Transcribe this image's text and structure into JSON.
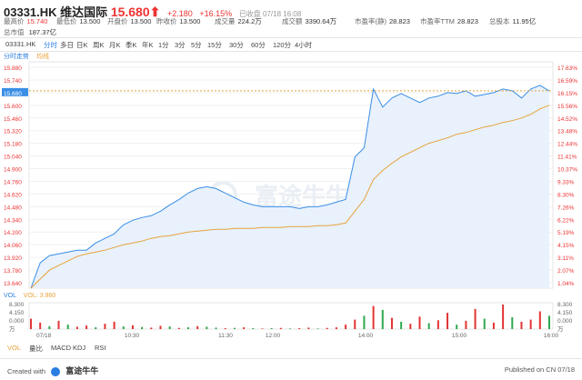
{
  "header": {
    "code": "03331.HK",
    "name": "维达国际",
    "price": "15.680",
    "arrow": "⬆",
    "change": "+2.180",
    "change_pct": "+16.15%",
    "status": "已收盘 07/18 16:08"
  },
  "stats": [
    {
      "label": "最高价",
      "value": "15.740",
      "red": true
    },
    {
      "label": "最低价",
      "value": "13.500",
      "red": false
    },
    {
      "label": "开盘价",
      "value": "13.500",
      "red": false
    },
    {
      "label": "昨收价",
      "value": "13.500",
      "red": false
    },
    {
      "label": "成交量",
      "value": "224.2万",
      "red": false
    },
    {
      "label": "成交额",
      "value": "3390.64万",
      "red": false
    },
    {
      "label": "市盈率(静)",
      "value": "28.823",
      "red": false
    },
    {
      "label": "市盈率TTM",
      "value": "28.823",
      "red": false
    },
    {
      "label": "总股本",
      "value": "11.95亿",
      "red": false
    }
  ],
  "market_cap": {
    "label": "总市值",
    "value": "187.37亿"
  },
  "tabs": [
    "03331.HK",
    "分时",
    "多日",
    "日K",
    "周K",
    "月K",
    "季K",
    "年K",
    "1分",
    "3分",
    "5分",
    "15分",
    "30分",
    "60分",
    "120分",
    "4小时"
  ],
  "active_tab": "分时",
  "legend": {
    "timeshare": "分时走势",
    "avg": "均线"
  },
  "volume_legend": {
    "label": "VOL",
    "value": "VOL: 3.960"
  },
  "bottom_tabs": [
    "VOL",
    "量比",
    "MACD",
    "KDJ",
    "RSI"
  ],
  "active_bottom_tab": "VOL",
  "footer": {
    "created_with": "Created with",
    "brand": "富途牛牛",
    "published": "Published on CN 07/18"
  },
  "watermark": "富途牛牛",
  "colors": {
    "up": "#e33333",
    "down": "#2fa84f",
    "line": "#3a8ee6",
    "avg": "#e8a23b",
    "fill": "#e8f1fc"
  },
  "chart_data": {
    "type": "line",
    "title": "",
    "xlabel": "",
    "ylabel": "",
    "x_ticks": [
      "07/18",
      "10:30",
      "11:30",
      "12:00",
      "14:00",
      "15:00",
      "16:00"
    ],
    "y_ticks": [
      "15.880",
      "15.740",
      "15.680",
      "15.600",
      "15.460",
      "15.320",
      "15.180",
      "15.040",
      "14.900",
      "14.760",
      "14.620",
      "14.480",
      "14.340",
      "14.200",
      "14.060",
      "13.920",
      "13.780",
      "13.640"
    ],
    "y_right_ticks": [
      "17.63%",
      "16.59%",
      "16.15%",
      "15.56%",
      "14.52%",
      "13.48%",
      "12.44%",
      "11.41%",
      "10.37%",
      "9.33%",
      "8.30%",
      "7.26%",
      "6.22%",
      "5.19%",
      "4.15%",
      "3.11%",
      "2.07%",
      "1.04%"
    ],
    "ylim": [
      13.5,
      16.0
    ],
    "prev_close": 13.5,
    "series": [
      {
        "name": "分时走势",
        "values": [
          13.5,
          13.78,
          13.86,
          13.88,
          13.9,
          13.92,
          13.92,
          14.0,
          14.05,
          14.1,
          14.2,
          14.25,
          14.28,
          14.3,
          14.35,
          14.42,
          14.48,
          14.55,
          14.6,
          14.62,
          14.6,
          14.55,
          14.5,
          14.45,
          14.42,
          14.4,
          14.4,
          14.4,
          14.4,
          14.38,
          14.4,
          14.4,
          14.42,
          14.45,
          14.48,
          14.95,
          15.05,
          15.7,
          15.5,
          15.6,
          15.65,
          15.6,
          15.55,
          15.6,
          15.62,
          15.66,
          15.65,
          15.68,
          15.62,
          15.64,
          15.66,
          15.7,
          15.68,
          15.6,
          15.7,
          15.74,
          15.68
        ]
      },
      {
        "name": "均线",
        "values": [
          13.5,
          13.6,
          13.7,
          13.75,
          13.8,
          13.85,
          13.88,
          13.9,
          13.92,
          13.95,
          13.98,
          14.0,
          14.02,
          14.05,
          14.07,
          14.08,
          14.1,
          14.12,
          14.13,
          14.14,
          14.15,
          14.15,
          14.16,
          14.16,
          14.16,
          14.17,
          14.17,
          14.17,
          14.18,
          14.18,
          14.18,
          14.19,
          14.19,
          14.2,
          14.22,
          14.35,
          14.48,
          14.7,
          14.8,
          14.88,
          14.95,
          15.0,
          15.05,
          15.1,
          15.13,
          15.16,
          15.2,
          15.22,
          15.25,
          15.28,
          15.3,
          15.33,
          15.35,
          15.38,
          15.42,
          15.48,
          15.52
        ]
      }
    ],
    "volume": {
      "y_ticks": [
        "8.300",
        "4.150",
        "0.000",
        "万"
      ],
      "values": [
        3.5,
        2.2,
        1.0,
        2.8,
        1.5,
        0.8,
        1.2,
        0.6,
        1.8,
        2.5,
        0.9,
        1.3,
        0.7,
        0.5,
        1.1,
        0.9,
        0.4,
        0.6,
        1.0,
        0.8,
        0.5,
        0.3,
        0.4,
        0.6,
        0.3,
        0.2,
        0.3,
        0.4,
        0.2,
        0.3,
        0.5,
        0.2,
        0.4,
        0.6,
        1.5,
        3.2,
        4.5,
        7.8,
        6.5,
        3.8,
        2.5,
        1.8,
        4.2,
        2.0,
        3.0,
        5.5,
        1.5,
        2.8,
        6.8,
        3.5,
        2.2,
        8.3,
        4.0,
        2.5,
        3.2,
        6.0,
        4.5
      ],
      "up": [
        true,
        true,
        false,
        true,
        false,
        true,
        true,
        false,
        true,
        true,
        false,
        true,
        false,
        true,
        true,
        false,
        true,
        false,
        true,
        false,
        false,
        true,
        false,
        true,
        false,
        true,
        false,
        true,
        false,
        true,
        true,
        false,
        true,
        true,
        true,
        true,
        false,
        true,
        false,
        true,
        false,
        true,
        true,
        false,
        true,
        true,
        false,
        true,
        true,
        false,
        true,
        true,
        false,
        true,
        true,
        true,
        false
      ]
    }
  }
}
